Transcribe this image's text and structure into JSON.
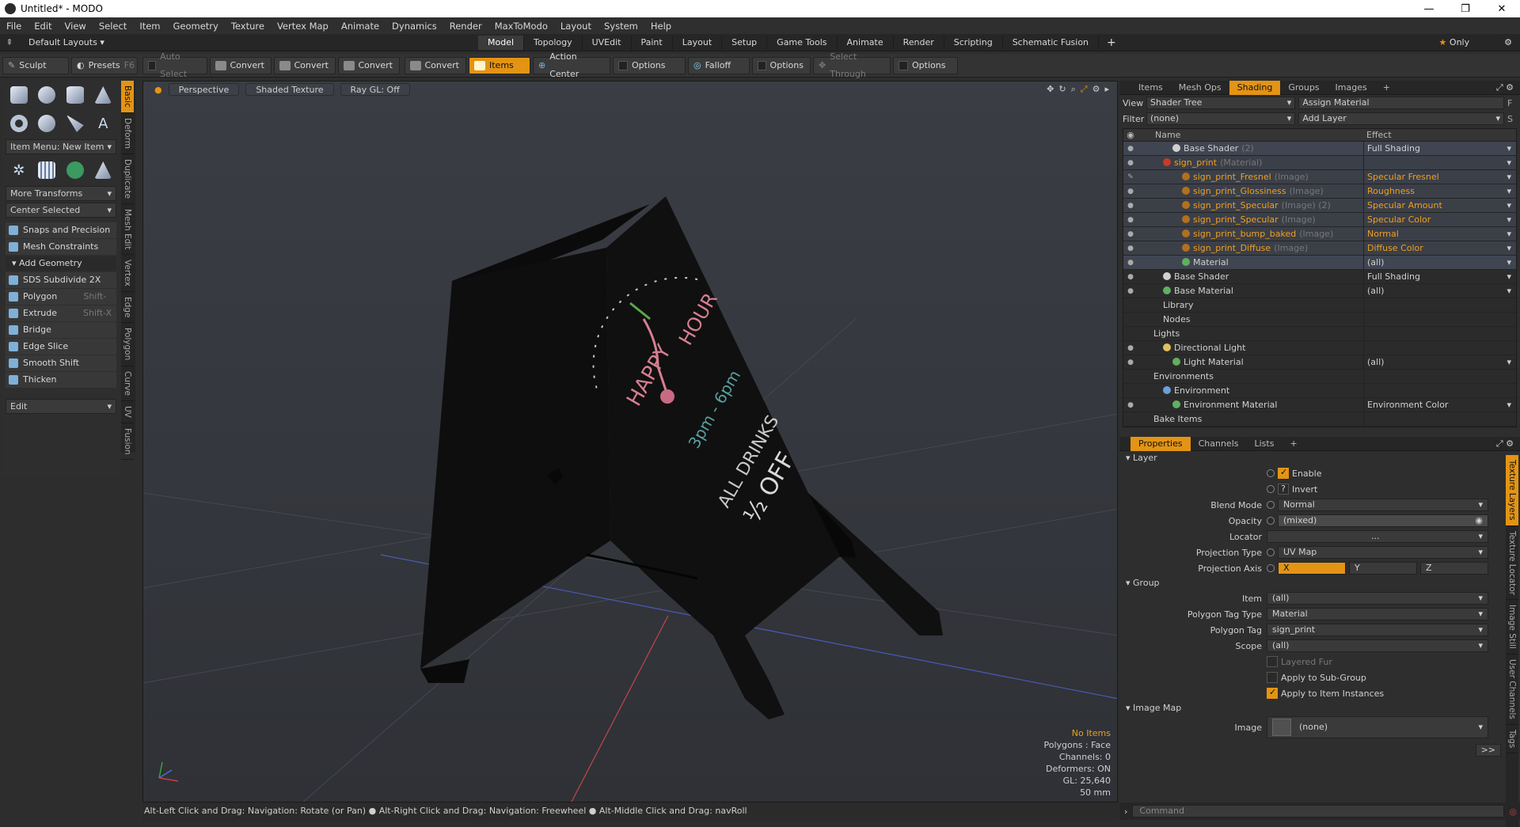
{
  "window": {
    "title": "Untitled* - MODO",
    "buttons": [
      "—",
      "❐",
      "✕"
    ]
  },
  "menu": [
    "File",
    "Edit",
    "View",
    "Select",
    "Item",
    "Geometry",
    "Texture",
    "Vertex Map",
    "Animate",
    "Dynamics",
    "Render",
    "MaxToModo",
    "Layout",
    "System",
    "Help"
  ],
  "layoutbar": {
    "layouts_label": "Default Layouts",
    "tabs": [
      "Model",
      "Topology",
      "UVEdit",
      "Paint",
      "Layout",
      "Setup",
      "Game Tools",
      "Animate",
      "Render",
      "Scripting",
      "Schematic Fusion"
    ],
    "active_tab": "Model",
    "add": "+",
    "only": "Only"
  },
  "toolbar": {
    "sculpt": "Sculpt",
    "presets": "Presets",
    "presets_key": "F6",
    "auto_select": "Auto Select",
    "convert1": "Convert",
    "convert2": "Convert",
    "convert3": "Convert",
    "convert4": "Convert",
    "items": "Items",
    "action_center": "Action Center",
    "options1": "Options",
    "falloff": "Falloff",
    "options2": "Options",
    "select_through": "Select Through",
    "options3": "Options"
  },
  "lefttools": {
    "item_menu": "Item Menu: New Item",
    "more_transforms": "More Transforms",
    "center_selected": "Center Selected",
    "snaps": "Snaps and Precision",
    "mesh_constraints": "Mesh Constraints",
    "add_geometry": "Add Geometry",
    "items": [
      {
        "label": "SDS Subdivide 2X",
        "key": ""
      },
      {
        "label": "Polygon Bevel",
        "key": "Shift-B"
      },
      {
        "label": "Extrude",
        "key": "Shift-X"
      },
      {
        "label": "Bridge",
        "key": ""
      },
      {
        "label": "Edge Slice",
        "key": ""
      },
      {
        "label": "Smooth Shift",
        "key": ""
      },
      {
        "label": "Thicken",
        "key": ""
      }
    ],
    "edit": "Edit",
    "vtabs": [
      "Basic",
      "Deform",
      "Duplicate",
      "Mesh Edit",
      "Vertex",
      "Edge",
      "Polygon",
      "Curve",
      "UV",
      "Fusion"
    ]
  },
  "viewport": {
    "buttons": [
      "Perspective",
      "Shaded Texture",
      "Ray GL: Off"
    ],
    "info": {
      "items": "No Items",
      "polygons": "Polygons : Face",
      "channels": "Channels: 0",
      "deformers": "Deformers: ON",
      "gl": "GL: 25,640",
      "focal": "50 mm"
    },
    "sign_text": {
      "line1": "HAPPY",
      "line2": "HOUR",
      "line3": "3pm - 6pm",
      "line4": "ALL DRINKS",
      "line5": "½ OFF"
    }
  },
  "status": "Alt-Left Click and Drag: Navigation: Rotate (or Pan) ● Alt-Right Click and Drag: Navigation: Freewheel ● Alt-Middle Click and Drag: navRoll",
  "shading": {
    "tabs": [
      "Items",
      "Mesh Ops",
      "Shading",
      "Groups",
      "Images",
      "+"
    ],
    "active_tab": "Shading",
    "view_label": "View",
    "view_value": "Shader Tree",
    "assign": "Assign Material",
    "filter_label": "Filter",
    "filter_value": "(none)",
    "add_layer": "Add Layer",
    "col_name": "Name",
    "col_effect": "Effect",
    "rows": [
      {
        "name": "Base Shader",
        "suffix": "(2)",
        "effect": "Full Shading",
        "indent": 3,
        "cls": "sel",
        "dot": "#d0d0d0",
        "eye": "●"
      },
      {
        "name": "sign_print",
        "suffix": "(Material)",
        "effect": "",
        "indent": 2,
        "cls": "hi or",
        "dot": "#c83a2a",
        "eye": "●"
      },
      {
        "name": "sign_print_Fresnel",
        "suffix": "(Image)",
        "effect": "Specular Fresnel",
        "indent": 4,
        "cls": "hi or",
        "dot": "#b07020",
        "eye": "✎"
      },
      {
        "name": "sign_print_Glossiness",
        "suffix": "(Image)",
        "effect": "Roughness",
        "indent": 4,
        "cls": "hi or",
        "dot": "#b07020",
        "eye": "●"
      },
      {
        "name": "sign_print_Specular",
        "suffix": "(Image) (2)",
        "effect": "Specular Amount",
        "indent": 4,
        "cls": "hi or",
        "dot": "#b07020",
        "eye": "●"
      },
      {
        "name": "sign_print_Specular",
        "suffix": "(Image)",
        "effect": "Specular Color",
        "indent": 4,
        "cls": "hi or",
        "dot": "#b07020",
        "eye": "●"
      },
      {
        "name": "sign_print_bump_baked",
        "suffix": "(Image)",
        "effect": "Normal",
        "indent": 4,
        "cls": "hi or",
        "dot": "#b07020",
        "eye": "●"
      },
      {
        "name": "sign_print_Diffuse",
        "suffix": "(Image)",
        "effect": "Diffuse Color",
        "indent": 4,
        "cls": "hi or",
        "dot": "#b07020",
        "eye": "●"
      },
      {
        "name": "Material",
        "suffix": "",
        "effect": "(all)",
        "indent": 4,
        "cls": "sel",
        "dot": "#5fb060",
        "eye": "●"
      },
      {
        "name": "Base Shader",
        "suffix": "",
        "effect": "Full Shading",
        "indent": 2,
        "cls": "",
        "dot": "#d0d0d0",
        "eye": "●"
      },
      {
        "name": "Base Material",
        "suffix": "",
        "effect": "(all)",
        "indent": 2,
        "cls": "",
        "dot": "#5fb060",
        "eye": "●"
      },
      {
        "name": "Library",
        "suffix": "",
        "effect": "",
        "indent": 2,
        "cls": "",
        "dot": "",
        "eye": ""
      },
      {
        "name": "Nodes",
        "suffix": "",
        "effect": "",
        "indent": 2,
        "cls": "",
        "dot": "",
        "eye": ""
      },
      {
        "name": "Lights",
        "suffix": "",
        "effect": "",
        "indent": 1,
        "cls": "",
        "dot": "",
        "eye": ""
      },
      {
        "name": "Directional Light",
        "suffix": "",
        "effect": "",
        "indent": 2,
        "cls": "",
        "dot": "#e0c060",
        "eye": "●"
      },
      {
        "name": "Light Material",
        "suffix": "",
        "effect": "(all)",
        "indent": 3,
        "cls": "",
        "dot": "#5fb060",
        "eye": "●"
      },
      {
        "name": "Environments",
        "suffix": "",
        "effect": "",
        "indent": 1,
        "cls": "",
        "dot": "",
        "eye": ""
      },
      {
        "name": "Environment",
        "suffix": "",
        "effect": "",
        "indent": 2,
        "cls": "",
        "dot": "#6aa0d8",
        "eye": ""
      },
      {
        "name": "Environment Material",
        "suffix": "",
        "effect": "Environment Color",
        "indent": 3,
        "cls": "",
        "dot": "#5fb060",
        "eye": "●"
      },
      {
        "name": "Bake Items",
        "suffix": "",
        "effect": "",
        "indent": 1,
        "cls": "",
        "dot": "",
        "eye": ""
      }
    ]
  },
  "properties": {
    "tabs": [
      "Properties",
      "Channels",
      "Lists",
      "+"
    ],
    "active_tab": "Properties",
    "layer_hdr": "Layer",
    "enable": "Enable",
    "invert": "Invert",
    "invert_q": "?",
    "blend_mode_label": "Blend Mode",
    "blend_mode": "Normal",
    "opacity_label": "Opacity",
    "opacity": "(mixed)",
    "locator_label": "Locator",
    "locator": "...",
    "proj_type_label": "Projection Type",
    "proj_type": "UV Map",
    "proj_axis_label": "Projection Axis",
    "axis_x": "X",
    "axis_y": "Y",
    "axis_z": "Z",
    "group_hdr": "Group",
    "item_label": "Item",
    "item": "(all)",
    "ptag_type_label": "Polygon Tag Type",
    "ptag_type": "Material",
    "ptag_label": "Polygon Tag",
    "ptag": "sign_print",
    "scope_label": "Scope",
    "scope": "(all)",
    "layered_fur": "Layered Fur",
    "apply_sub": "Apply to Sub-Group",
    "apply_inst": "Apply to Item Instances",
    "imagemap_hdr": "Image Map",
    "image_label": "Image",
    "image": "(none)",
    "more": ">>",
    "side_tabs": [
      "Texture Layers",
      "Texture Locator",
      "Image Still",
      "User Channels",
      "Tags"
    ]
  },
  "command": {
    "placeholder": "Command"
  },
  "colors": {
    "accent": "#e39414",
    "orange_text": "#f0a020"
  }
}
